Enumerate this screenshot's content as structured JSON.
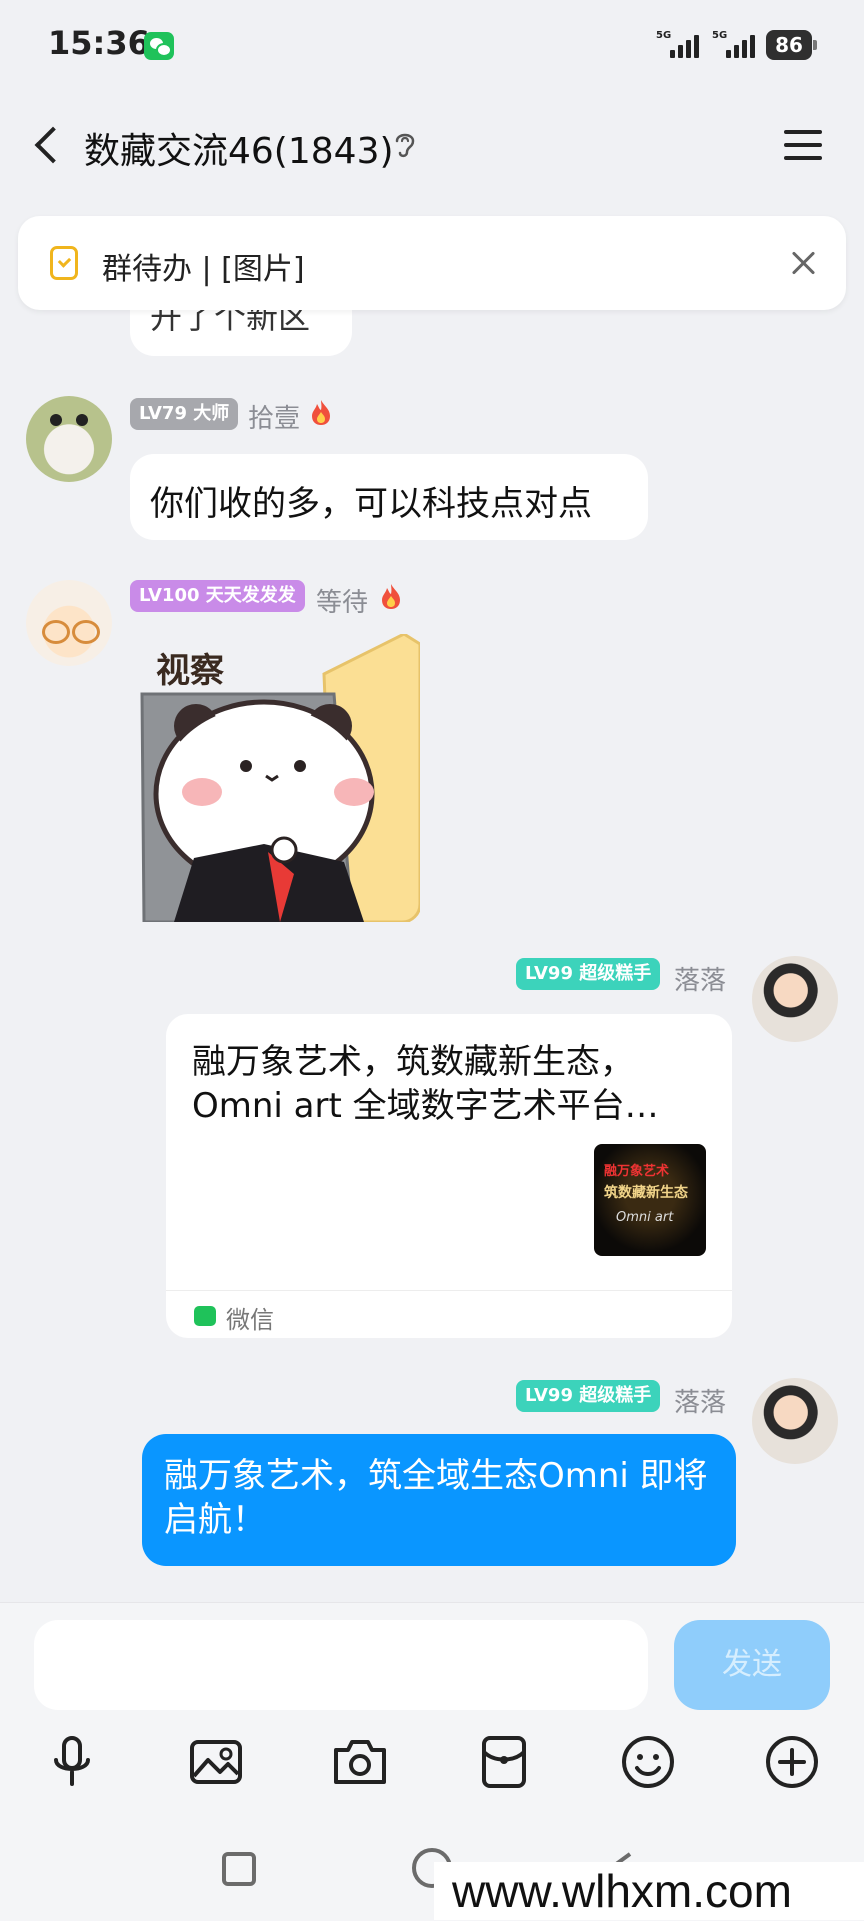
{
  "status_bar": {
    "time": "15:36",
    "network_1": "5G",
    "network_2": "5G",
    "battery": "86"
  },
  "header": {
    "title": "数藏交流46(1843)",
    "icons": [
      "back-arrow-icon",
      "ear-icon",
      "menu-icon"
    ]
  },
  "todo_banner": {
    "text": "群待办 | [图片]"
  },
  "messages": [
    {
      "type": "text",
      "partial": true,
      "text": "开了个新区"
    },
    {
      "type": "text",
      "side": "left",
      "badge": "LV79 大师",
      "name": "拾壹",
      "text": "你们收的多，可以科技点对点",
      "badge_color": "#a7a8ad"
    },
    {
      "type": "sticker",
      "side": "left",
      "badge": "LV100 天天发发发",
      "name": "等待",
      "sticker_text": "视察",
      "badge_color": "#c98be8"
    },
    {
      "type": "link",
      "side": "right",
      "badge": "LV99 超级糕手",
      "name": "落落",
      "title": "融万象艺术，筑数藏新生态，Omni art 全域数字艺术平台…",
      "thumb_lines": [
        "融万象艺术",
        "筑数藏新生态",
        "Omni art"
      ],
      "source": "微信",
      "badge_color": "#3cd3bb"
    },
    {
      "type": "text",
      "side": "right",
      "badge": "LV99 超级糕手",
      "name": "落落",
      "text": "融万象艺术，筑全域生态Omni 即将启航！",
      "bubble_color": "#0a96ff"
    }
  ],
  "input": {
    "value": "",
    "send_label": "发送"
  },
  "toolbar": [
    "mic-icon",
    "image-icon",
    "camera-icon",
    "red-packet-icon",
    "emoji-icon",
    "plus-icon"
  ],
  "watermark": "www.wlhxm.com"
}
